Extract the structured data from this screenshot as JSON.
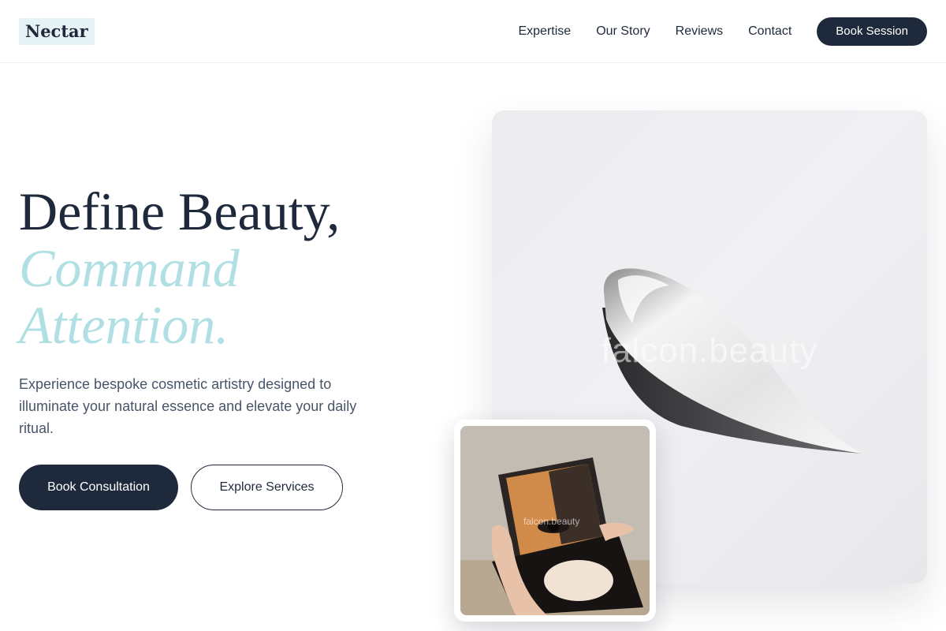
{
  "brand": {
    "logo": "Nectar"
  },
  "nav": {
    "links": [
      "Expertise",
      "Our Story",
      "Reviews",
      "Contact"
    ],
    "cta": "Book Session"
  },
  "hero": {
    "headline_line1": "Define Beauty,",
    "headline_line2": "Command",
    "headline_line3": "Attention.",
    "subtext": "Experience bespoke cosmetic artistry designed to illuminate your natural essence and elevate your daily ritual.",
    "primary_button": "Book Consultation",
    "secondary_button": "Explore Services"
  },
  "images": {
    "main_watermark": "falcon.beauty",
    "inset_watermark": "falcon.beauty"
  },
  "colors": {
    "navy": "#1e293b",
    "accent_teal": "#b0dfe4",
    "logo_bg": "#e6f3f5",
    "body_text": "#475569"
  }
}
